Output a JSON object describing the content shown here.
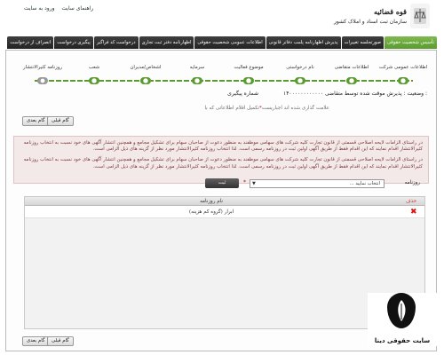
{
  "header": {
    "logo_title": "قوه قضائیه",
    "logo_subtitle": "سازمان ثبت اسناد و املاک کشور",
    "top_links": [
      "راهنمای سایت",
      "ورود به سایت"
    ]
  },
  "tabs": [
    {
      "label": "تأسیس شخصیت حقوقی",
      "active": true
    },
    {
      "label": "صورتجلسه تغییرات",
      "active": false
    },
    {
      "label": "پذیرش اظهارنامه پلمب دفاتر قانونی",
      "active": false
    },
    {
      "label": "اطلاعات عمومی شخصیت حقوقی",
      "active": false
    },
    {
      "label": "اظهارنامه دفتر ثبت تجاری",
      "active": false
    },
    {
      "label": "درخواست کد فراگیر",
      "active": false
    },
    {
      "label": "پیگیری درخواست",
      "active": false
    },
    {
      "label": "انصراف از درخواست",
      "active": false
    }
  ],
  "steps": [
    "اطلاعات عمومی شرکت",
    "اطلاعات متقاضی",
    "نام درخواستی",
    "موضوع فعالیت",
    "سرمایه",
    "اشخاص/مدیران",
    "شعب",
    "روزنامه کثیرالانتشار"
  ],
  "meta": {
    "tracking_label": "شماره پیگیری :",
    "tracking_value": "۱۴۰۰۰۰۰۰۰۰۰۰۰۰",
    "status": "وضعیت : پذیرش موقت شده توسط متقاضی"
  },
  "hint": {
    "prefix": "تکمیل اقلام اطلاعاتی که با ",
    "star": "*",
    "suffix": " علامت گذاری شده اند اجباریست"
  },
  "buttons": {
    "next": "گام بعدی",
    "prev": "گام قبلی",
    "add": "ثبت"
  },
  "notice": [
    "در راستای الزامات لایحه اصلاحی قسمتی از قانون تجارت کلیه شرکت های سهامی موظفند به منظور دعوت از صاحبان سهام برای تشکیل مجامع و همچنین انتشار آگهی های خود نسبت به انتخاب روزنامه کثیرالانتشار اقدام نمایند که این اقدام فقط از طریق آگهی اولین ثبت در روزنامه رسمی است. لذا انتخاب روزنامه کثیرالانتشار مورد نظر از گزینه های ذیل الزامی است.",
    "در راستای الزامات لایحه اصلاحی قسمتی از قانون تجارت کلیه شرکت های سهامی موظفند به منظور دعوت از صاحبان سهام برای تشکیل مجامع و همچنین انتشار آگهی های خود نسبت به انتخاب روزنامه کثیرالانتشار اقدام نمایند که این اقدام فقط از طریق آگهی اولین ثبت در روزنامه رسمی است. لذا انتخاب روزنامه کثیرالانتشار مورد نظر از گزینه های ذیل الزامی است."
  ],
  "newspaper_select": {
    "label": "روزنامه",
    "value": "انتخاب نمایید ..."
  },
  "grid": {
    "headers": {
      "name": "نام روزنامه",
      "delete": "حذف"
    },
    "rows": [
      {
        "name": "ابرار (گروه کم هزینه)"
      }
    ]
  },
  "watermark": {
    "text": "سایت حقوقی دینا"
  }
}
